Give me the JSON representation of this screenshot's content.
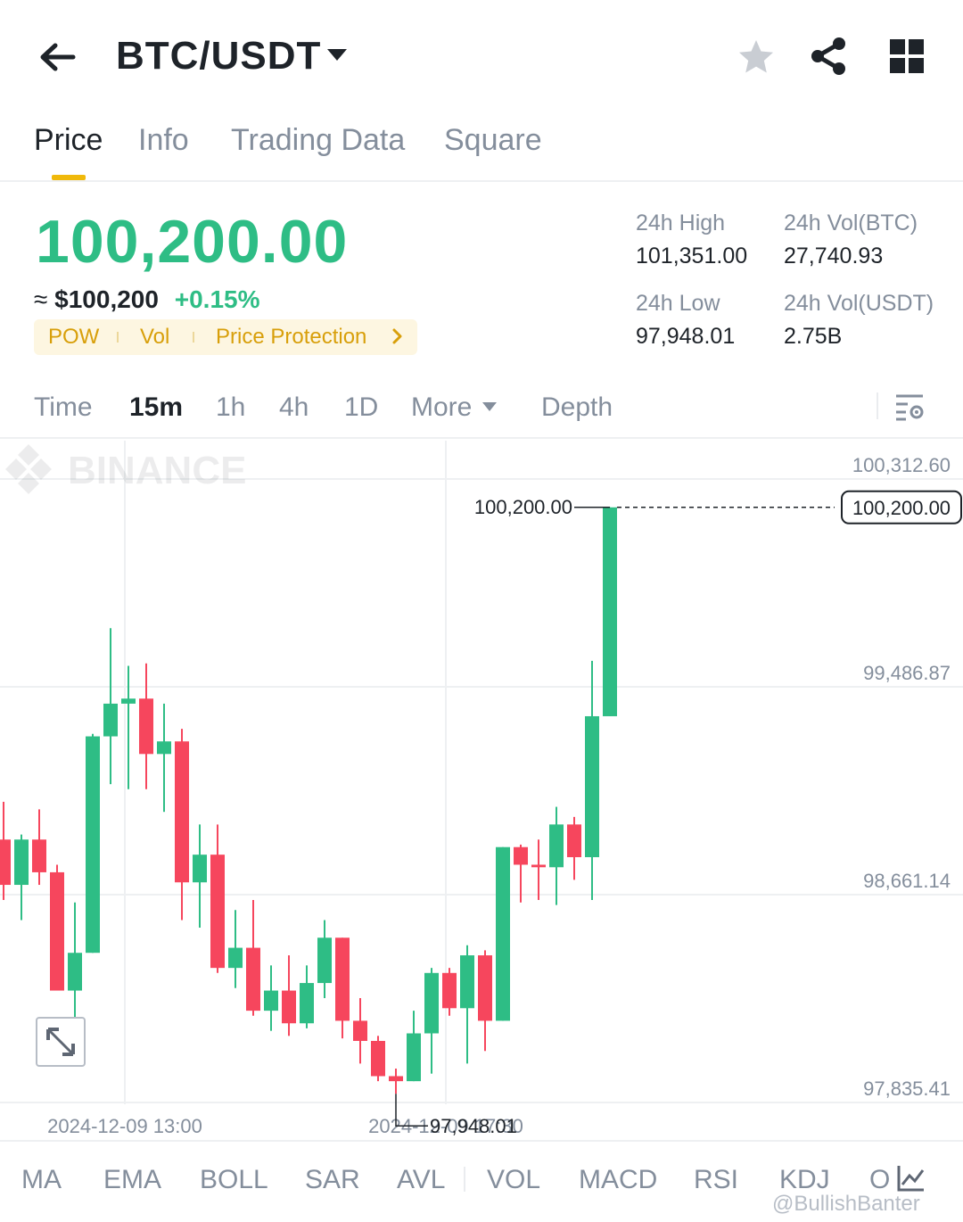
{
  "header": {
    "pair": "BTC/USDT",
    "icons": [
      "back-arrow-icon",
      "caret-down-icon",
      "star-icon",
      "share-icon",
      "grid-menu-icon"
    ]
  },
  "tabs": [
    {
      "label": "Price",
      "active": true
    },
    {
      "label": "Info",
      "active": false
    },
    {
      "label": "Trading Data",
      "active": false
    },
    {
      "label": "Square",
      "active": false
    }
  ],
  "price": {
    "last": "100,200.00",
    "approx_prefix": "≈",
    "approx_fiat": "$100,200",
    "change": "+0.15%",
    "tags": [
      "POW",
      "Vol",
      "Price Protection"
    ]
  },
  "stats": {
    "high_label": "24h High",
    "high_value": "101,351.00",
    "low_label": "24h Low",
    "low_value": "97,948.01",
    "vol_btc_label": "24h Vol(BTC)",
    "vol_btc_value": "27,740.93",
    "vol_usdt_label": "24h Vol(USDT)",
    "vol_usdt_value": "2.75B"
  },
  "intervals": {
    "items": [
      "Time",
      "15m",
      "1h",
      "4h",
      "1D",
      "More",
      "Depth"
    ],
    "active": "15m"
  },
  "colors": {
    "up": "#2ebd85",
    "down": "#f6465d",
    "accent": "#f0b90b",
    "text": "#1e2329",
    "muted": "#848e9c"
  },
  "chart_data": {
    "type": "candlestick",
    "y_ticks": [
      "100,312.60",
      "99,486.87",
      "98,661.14",
      "97,835.41"
    ],
    "y_tick_values": [
      100312.6,
      99486.87,
      98661.14,
      97835.41
    ],
    "x_ticks": [
      "2024-12-09 13:00",
      "2024-12-09 17:30"
    ],
    "last_price_label": "100,200.00",
    "high_marker_label": "100,200.00",
    "low_marker_label": "97,948.01",
    "high_marker_value": 100200.0,
    "low_marker_value": 97948.01,
    "candles": [
      {
        "o": 98880,
        "h": 99030,
        "l": 98640,
        "c": 98700
      },
      {
        "o": 98700,
        "h": 98900,
        "l": 98560,
        "c": 98880
      },
      {
        "o": 98880,
        "h": 99000,
        "l": 98700,
        "c": 98750
      },
      {
        "o": 98750,
        "h": 98780,
        "l": 98280,
        "c": 98280
      },
      {
        "o": 98280,
        "h": 98630,
        "l": 98130,
        "c": 98430
      },
      {
        "o": 98430,
        "h": 99300,
        "l": 98430,
        "c": 99290
      },
      {
        "o": 99290,
        "h": 99720,
        "l": 99100,
        "c": 99420
      },
      {
        "o": 99420,
        "h": 99570,
        "l": 99080,
        "c": 99440
      },
      {
        "o": 99440,
        "h": 99580,
        "l": 99080,
        "c": 99220
      },
      {
        "o": 99220,
        "h": 99420,
        "l": 98990,
        "c": 99270
      },
      {
        "o": 99270,
        "h": 99320,
        "l": 98560,
        "c": 98710
      },
      {
        "o": 98710,
        "h": 98940,
        "l": 98530,
        "c": 98820
      },
      {
        "o": 98820,
        "h": 98940,
        "l": 98350,
        "c": 98370
      },
      {
        "o": 98370,
        "h": 98600,
        "l": 98290,
        "c": 98450
      },
      {
        "o": 98450,
        "h": 98640,
        "l": 98180,
        "c": 98200
      },
      {
        "o": 98200,
        "h": 98380,
        "l": 98120,
        "c": 98280
      },
      {
        "o": 98280,
        "h": 98420,
        "l": 98100,
        "c": 98150
      },
      {
        "o": 98150,
        "h": 98380,
        "l": 98130,
        "c": 98310
      },
      {
        "o": 98310,
        "h": 98560,
        "l": 98250,
        "c": 98490
      },
      {
        "o": 98490,
        "h": 98490,
        "l": 98090,
        "c": 98160
      },
      {
        "o": 98160,
        "h": 98250,
        "l": 97990,
        "c": 98080
      },
      {
        "o": 98080,
        "h": 98100,
        "l": 97920,
        "c": 97940
      },
      {
        "o": 97940,
        "h": 97970,
        "l": 97870,
        "c": 97920
      },
      {
        "o": 97920,
        "h": 98200,
        "l": 97920,
        "c": 98110
      },
      {
        "o": 98110,
        "h": 98370,
        "l": 97950,
        "c": 98350
      },
      {
        "o": 98350,
        "h": 98370,
        "l": 98180,
        "c": 98210
      },
      {
        "o": 98210,
        "h": 98460,
        "l": 97990,
        "c": 98420
      },
      {
        "o": 98420,
        "h": 98440,
        "l": 98040,
        "c": 98160
      },
      {
        "o": 98160,
        "h": 98850,
        "l": 98160,
        "c": 98850
      },
      {
        "o": 98850,
        "h": 98860,
        "l": 98630,
        "c": 98780
      },
      {
        "o": 98780,
        "h": 98880,
        "l": 98640,
        "c": 98770
      },
      {
        "o": 98770,
        "h": 99010,
        "l": 98620,
        "c": 98940
      },
      {
        "o": 98940,
        "h": 98970,
        "l": 98720,
        "c": 98810
      },
      {
        "o": 98810,
        "h": 99590,
        "l": 98640,
        "c": 99370
      },
      {
        "o": 99370,
        "h": 100200,
        "l": 99370,
        "c": 100200
      }
    ]
  },
  "indicators": {
    "items": [
      "MA",
      "EMA",
      "BOLL",
      "SAR",
      "AVL",
      "VOL",
      "MACD",
      "RSI",
      "KDJ",
      "O"
    ]
  },
  "watermark": "BINANCE",
  "credit": "@BullishBanter"
}
